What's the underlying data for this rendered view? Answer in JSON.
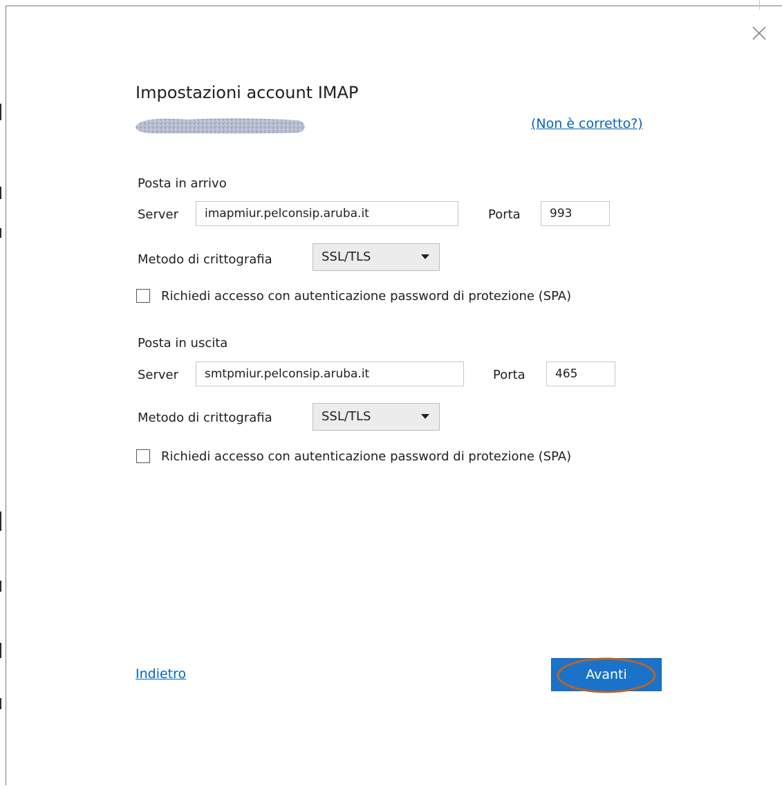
{
  "dialog": {
    "title": "Impostazioni account IMAP",
    "account_email_redacted": true,
    "not_correct_link": "(Non è corretto?)",
    "close_icon": "close-icon"
  },
  "incoming": {
    "section_label": "Posta in arrivo",
    "server_label": "Server",
    "server_value": "imapmiur.pelconsip.aruba.it",
    "port_label": "Porta",
    "port_value": "993",
    "encryption_label": "Metodo di crittografia",
    "encryption_value": "SSL/TLS",
    "spa_label": "Richiedi accesso con autenticazione password di protezione (SPA)",
    "spa_checked": false
  },
  "outgoing": {
    "section_label": "Posta in uscita",
    "server_label": "Server",
    "server_value": "smtpmiur.pelconsip.aruba.it",
    "port_label": "Porta",
    "port_value": "465",
    "encryption_label": "Metodo di crittografia",
    "encryption_value": "SSL/TLS",
    "spa_label": "Richiedi accesso con autenticazione password di protezione (SPA)",
    "spa_checked": false
  },
  "footer": {
    "back_label": "Indietro",
    "next_label": "Avanti"
  },
  "colors": {
    "link": "#0563c1",
    "primary_button": "#1a73c9",
    "annotation": "#b5652a"
  }
}
